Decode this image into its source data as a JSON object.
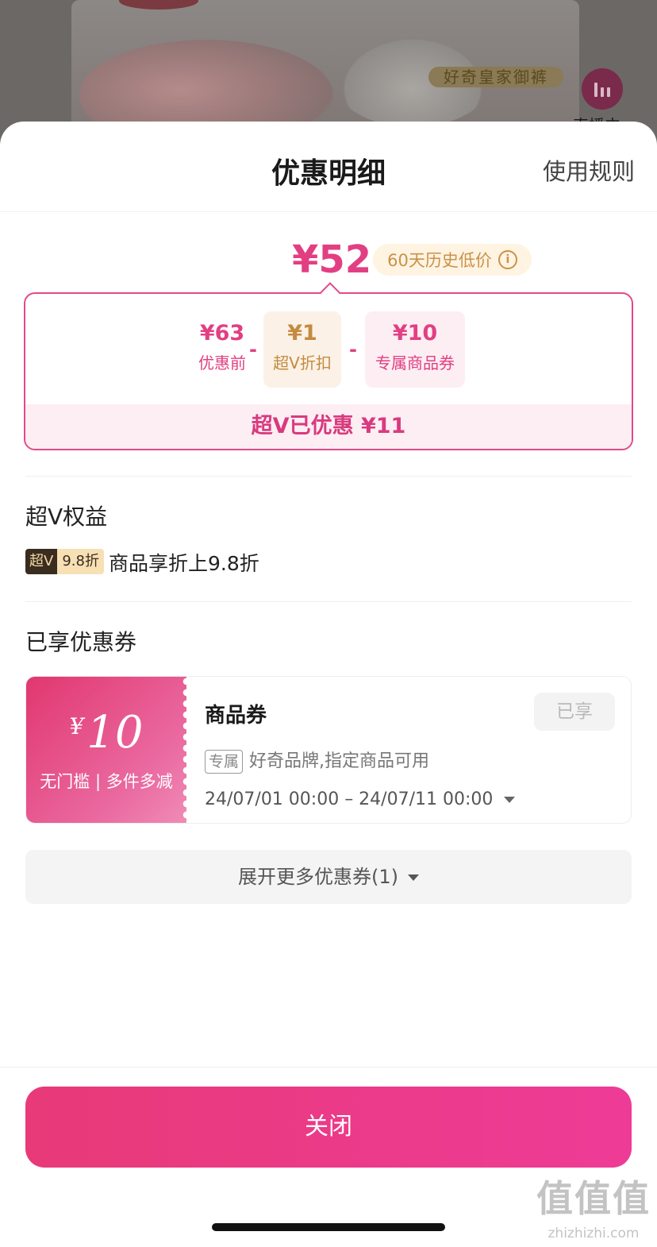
{
  "background": {
    "banner_text": "好奇皇家御裤",
    "live_label": "直播中"
  },
  "sheet": {
    "title": "优惠明细",
    "rules_link": "使用规则"
  },
  "price": {
    "final": "¥52",
    "history_tag": "60天历史低价",
    "info_icon": "i"
  },
  "breakdown": {
    "before_amount": "¥63",
    "before_label": "优惠前",
    "minus": "-",
    "vip_amount": "¥1",
    "vip_label": "超V折扣",
    "coupon_amount": "¥10",
    "coupon_label": "专属商品券",
    "total": "超V已优惠 ¥11"
  },
  "vip_rights": {
    "title": "超V权益",
    "badge_left": "超V",
    "badge_right": "9.8折",
    "description": "商品享折上9.8折"
  },
  "coupons": {
    "title": "已享优惠券",
    "items": [
      {
        "currency": "¥",
        "amount": "10",
        "condition": "无门槛 | 多件多减",
        "name": "商品券",
        "status": "已享",
        "tag": "专属",
        "scope": "好奇品牌,指定商品可用",
        "validity": "24/07/01 00:00 – 24/07/11 00:00"
      }
    ],
    "expand_label": "展开更多优惠券(1)"
  },
  "footer": {
    "close_label": "关闭"
  },
  "watermark": {
    "mark": "值值值",
    "site": "zhizhizhi.com"
  },
  "colors": {
    "accent_pink": "#e23f83",
    "gold": "#c48b3f",
    "close_gradient_start": "#e83a78",
    "close_gradient_end": "#ee3b97"
  }
}
